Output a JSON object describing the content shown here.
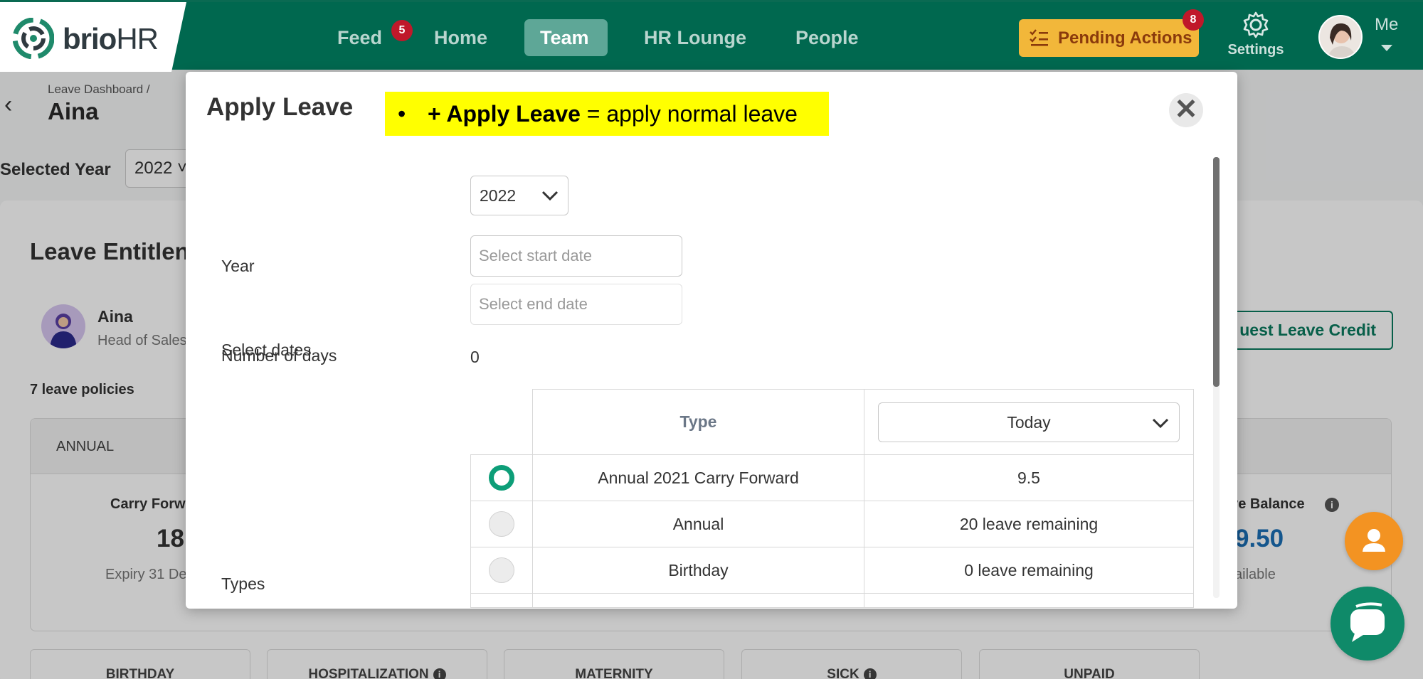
{
  "brand": {
    "name_bold": "brio",
    "name_light": "HR",
    "colors": {
      "primary": "#00684f",
      "pending": "#f2b73a",
      "badge": "#c0182a",
      "highlight": "#ffff00",
      "radio_selected": "#0d9e78"
    }
  },
  "nav": {
    "items": [
      {
        "label": "Feed",
        "badge": "5"
      },
      {
        "label": "Home"
      },
      {
        "label": "Team",
        "active": true
      },
      {
        "label": "HR Lounge"
      },
      {
        "label": "People"
      }
    ],
    "pending": {
      "label": "Pending Actions",
      "badge": "8",
      "icon": "checklist-icon"
    },
    "settings_label": "Settings",
    "me_label": "Me"
  },
  "background_page": {
    "breadcrumb": "Leave Dashboard /",
    "title": "Aina",
    "selected_year_label": "Selected Year",
    "selected_year_value": "2022",
    "section_title": "Leave Entitlen",
    "employee": {
      "name": "Aina",
      "role": "Head of Sales"
    },
    "policies_count": "7 leave policies",
    "request_credit_label": "uest Leave Credit",
    "annual_card": {
      "label": "ANNUAL",
      "carry_forward_label": "Carry Forw",
      "carry_forward_value": "18",
      "expiry_label": "Expiry 31 De",
      "balance_label": "ave Balance",
      "balance_value": "9.50",
      "available_label": "ailable"
    },
    "mini_cards": [
      {
        "label": "BIRTHDAY"
      },
      {
        "label": "HOSPITALIZATION",
        "info": true
      },
      {
        "label": "MATERNITY"
      },
      {
        "label": "SICK",
        "info": true
      },
      {
        "label": "UNPAID"
      }
    ]
  },
  "modal": {
    "title": "Apply Leave",
    "note": {
      "bullet": "•",
      "bold": "+ Apply Leave",
      "rest": " = apply normal leave"
    },
    "close_symbol": "✕",
    "year_label": "Year",
    "year_value": "2022",
    "dates_label": "Select dates",
    "start_placeholder": "Select start date",
    "end_placeholder": "Select end date",
    "days_label": "Number of days",
    "days_value": "0",
    "types_label": "Types",
    "table": {
      "type_header": "Type",
      "period_select": "Today",
      "rows": [
        {
          "type": "Annual 2021 Carry Forward",
          "balance": "9.5",
          "selected": true
        },
        {
          "type": "Annual",
          "balance": "20 leave remaining",
          "selected": false
        },
        {
          "type": "Birthday",
          "balance": "0 leave remaining",
          "selected": false
        }
      ]
    }
  }
}
